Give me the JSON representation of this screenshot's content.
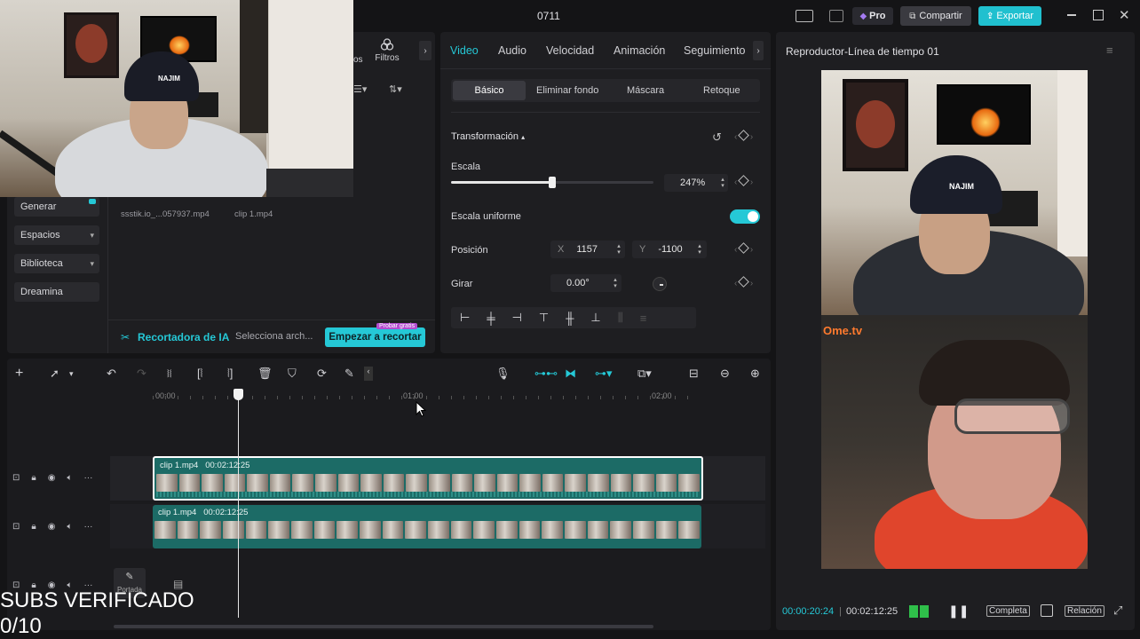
{
  "window": {
    "title": "0711",
    "pro_label": "Pro",
    "share_label": "Compartir",
    "export_label": "Exportar"
  },
  "left_panel": {
    "tabs_partial": "os",
    "filters_label": "Filtros",
    "sidebar": [
      {
        "label": "Generar"
      },
      {
        "label": "Espacios"
      },
      {
        "label": "Biblioteca"
      },
      {
        "label": "Dreamina"
      }
    ],
    "media": [
      {
        "name": "ssstik.io_...057937.mp4"
      },
      {
        "name": "clip 1.mp4"
      }
    ],
    "ai_cutter": {
      "label": "Recortadora de IA",
      "select_label": "Selecciona arch...",
      "button_label": "Empezar a recortar",
      "badge": "Probar gratis"
    }
  },
  "inspector": {
    "tabs": [
      "Video",
      "Audio",
      "Velocidad",
      "Animación",
      "Seguimiento"
    ],
    "active_tab": "Video",
    "subtabs": [
      "Básico",
      "Eliminar fondo",
      "Máscara",
      "Retoque"
    ],
    "active_subtab": "Básico",
    "section": "Transformación",
    "scale": {
      "label": "Escala",
      "value": "247%",
      "slider_fraction": 0.5
    },
    "uniform_scale": {
      "label": "Escala uniforme",
      "on": true
    },
    "position": {
      "label": "Posición",
      "x_label": "X",
      "x": "1157",
      "y_label": "Y",
      "y": "-1100"
    },
    "rotate": {
      "label": "Girar",
      "value": "0.00°"
    }
  },
  "player": {
    "title": "Reproductor-Línea de tiempo 01",
    "overlay_logo": "Ome.tv",
    "current_time": "00:00:20:24",
    "total_time": "00:02:12:25",
    "full_label": "Completa",
    "ratio_label": "Relación"
  },
  "timeline": {
    "ruler": [
      "00:00",
      "01:00",
      "02:00"
    ],
    "tracks": [
      {
        "clip_name": "clip 1.mp4",
        "duration": "00:02:12:25"
      },
      {
        "clip_name": "clip 1.mp4",
        "duration": "00:02:12:25"
      }
    ],
    "cover_label": "Portada"
  },
  "overlay_text": {
    "line1": "SUBS VERIFICADO",
    "line2": "0/10"
  },
  "colors": {
    "accent": "#25c8d6",
    "clip": "#1c6b66",
    "bg": "#141416",
    "panel": "#1e1e21"
  }
}
